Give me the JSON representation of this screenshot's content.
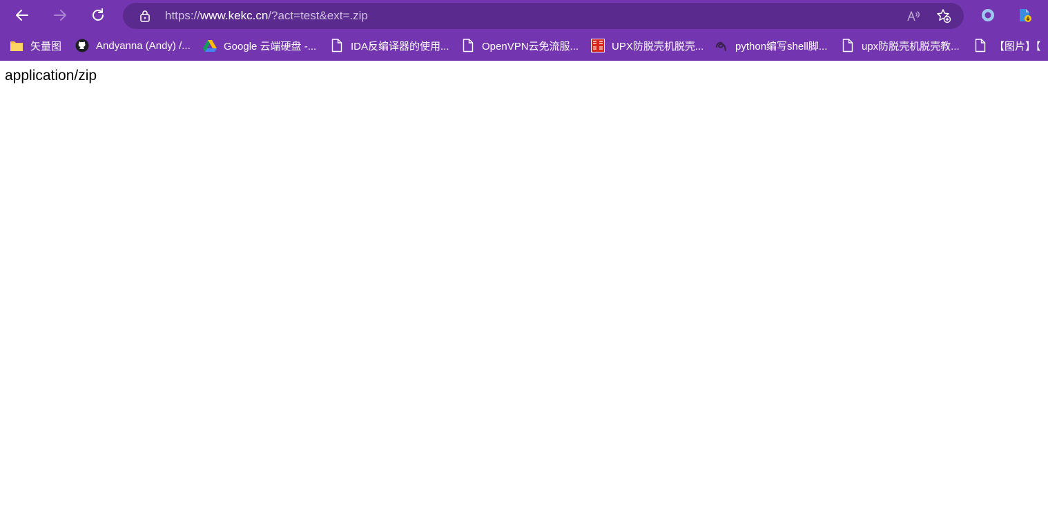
{
  "address_bar": {
    "url_scheme": "https://",
    "url_host": "www.kekc.cn",
    "url_path": "/?act=test&ext=.zip"
  },
  "icons": {
    "back": "back-arrow-icon",
    "forward": "forward-arrow-icon",
    "refresh": "refresh-icon",
    "lock": "lock-icon",
    "read_aloud": "read-aloud-icon",
    "favorites": "add-favorite-icon",
    "extension": "circle-extension-icon",
    "download": "download-icon"
  },
  "bookmarks": [
    {
      "label": "矢量图",
      "icon": "folder-icon"
    },
    {
      "label": "Andyanna (Andy) /...",
      "icon": "github-icon"
    },
    {
      "label": "Google 云端硬盘 -...",
      "icon": "google-drive-icon"
    },
    {
      "label": "IDA反编译器的使用...",
      "icon": "page-icon"
    },
    {
      "label": "OpenVPN云免流服...",
      "icon": "page-icon"
    },
    {
      "label": "UPX防脱壳机脱壳...",
      "icon": "red-seal-icon"
    },
    {
      "label": "python编写shell脚...",
      "icon": "swirl-icon"
    },
    {
      "label": "upx防脱壳机脱壳教...",
      "icon": "page-icon"
    },
    {
      "label": "【图片】【",
      "icon": "page-icon"
    }
  ],
  "page": {
    "body_text": "application/zip"
  },
  "colors": {
    "toolbar_bg": "#7436b0",
    "addressbar_bg": "#5b2a8e"
  }
}
